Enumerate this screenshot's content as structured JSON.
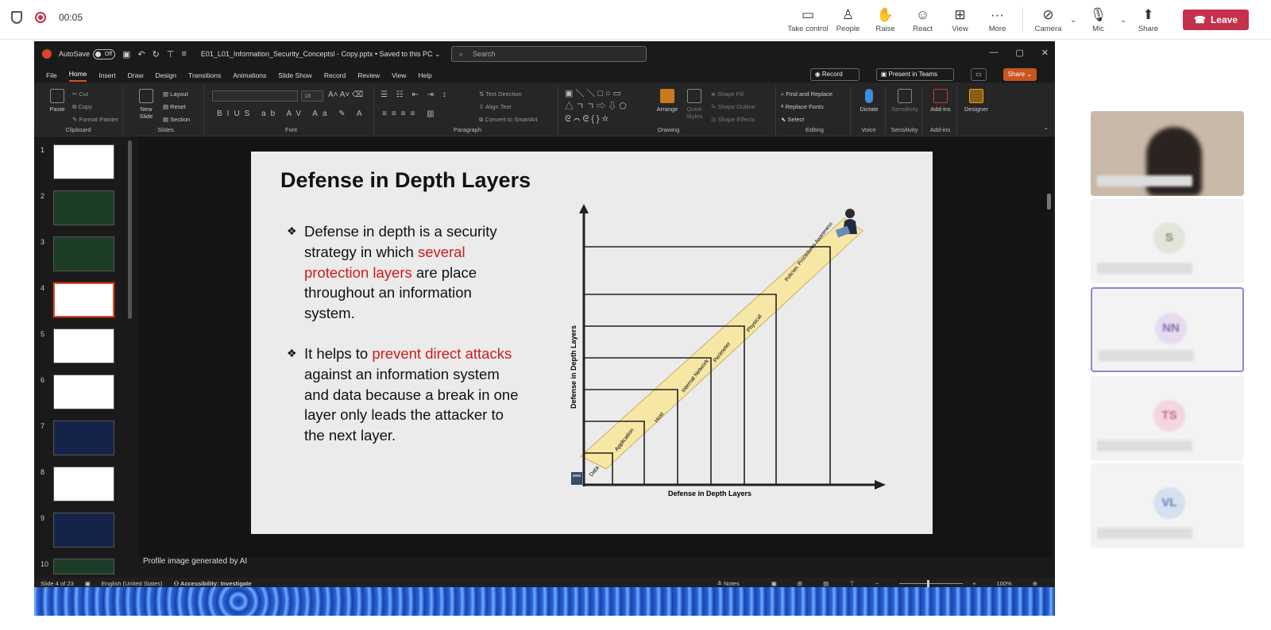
{
  "teams": {
    "timer": "00:05",
    "controls": [
      {
        "label": "Take control",
        "icon": "take-control-icon",
        "glyph": "▭"
      },
      {
        "label": "People",
        "icon": "people-icon",
        "glyph": "♙"
      },
      {
        "label": "Raise",
        "icon": "raise-hand-icon",
        "glyph": "✋"
      },
      {
        "label": "React",
        "icon": "react-icon",
        "glyph": "☺"
      },
      {
        "label": "View",
        "icon": "view-icon",
        "glyph": "⊞"
      },
      {
        "label": "More",
        "icon": "more-icon",
        "glyph": "···"
      }
    ],
    "camera_label": "Camera",
    "mic_label": "Mic",
    "share_label": "Share",
    "leave_label": "Leave"
  },
  "ppt": {
    "autosave_label": "AutoSave",
    "autosave_state": "Off",
    "filename": "E01_L01_Information_Security_Conceptsl - Copy.pptx • Saved to this PC ⌄",
    "search_placeholder": "Search",
    "menus": [
      "File",
      "Home",
      "Insert",
      "Draw",
      "Design",
      "Transitions",
      "Animations",
      "Slide Show",
      "Record",
      "Review",
      "View",
      "Help"
    ],
    "record_label": "Record",
    "present_label": "Present in Teams",
    "share_label": "Share ⌄",
    "ribbon": {
      "paste": "Paste",
      "cut": "Cut",
      "copy": "Copy",
      "format_painter": "Format Painter",
      "clipboard": "Clipboard",
      "new_slide": "New Slide",
      "layout": "Layout",
      "reset": "Reset",
      "section": "Section",
      "slides": "Slides",
      "font_size": "18",
      "font": "Font",
      "paragraph": "Paragraph",
      "text_direction": "Text Direction",
      "align_text": "Align Text",
      "convert_smartart": "Convert to SmartArt",
      "arrange": "Arrange",
      "quick_styles": "Quick Styles",
      "shape_fill": "Shape Fill",
      "shape_outline": "Shape Outline",
      "shape_effects": "Shape Effects",
      "drawing": "Drawing",
      "find_replace": "Find and Replace",
      "replace_fonts": "Replace Fonts",
      "select": "Select",
      "editing": "Editing",
      "dictate": "Dictate",
      "voice": "Voice",
      "sensitivity": "Sensitivity",
      "sensitivity_grp": "Sensitivity",
      "addins": "Add-ins",
      "addins_grp": "Add-ins",
      "designer": "Designer"
    },
    "slide_numbers": [
      "1",
      "2",
      "3",
      "4",
      "5",
      "6",
      "7",
      "8",
      "9",
      "10"
    ],
    "slide": {
      "title": "Defense in Depth Layers",
      "b1_a": "Defense in depth is a security strategy in which ",
      "b1_red": "several protection layers",
      "b1_b": " are place throughout an information system.",
      "b2_a": "It helps to ",
      "b2_red": "prevent direct attacks",
      "b2_b": " against an information system and data because a break in one layer only leads the attacker to the next layer.",
      "y_axis": "Defense in Depth Layers",
      "x_axis": "Defense in Depth Layers",
      "layers": [
        "Data",
        "Application",
        "Host",
        "Internal Network",
        "Perimeter",
        "Physical",
        "Policies, Procedures Awareness"
      ]
    },
    "notes_text": "Profile image generated by AI",
    "status": {
      "slide_of": "Slide 4 of 23",
      "language": "English (United States)",
      "accessibility": "Accessibility: Investigate",
      "notes": "Notes",
      "zoom": "100%"
    }
  },
  "participants": [
    {
      "initials": "",
      "kind": "video"
    },
    {
      "initials": "S",
      "bg": "#e2e6da",
      "fg": "#7a8a6a"
    },
    {
      "initials": "NN",
      "bg": "#e6dcef",
      "fg": "#8b6aa8",
      "highlight": true
    },
    {
      "initials": "TS",
      "bg": "#f3d6de",
      "fg": "#c06a85"
    },
    {
      "initials": "VL",
      "bg": "#d6e1f0",
      "fg": "#5e7fb0"
    }
  ]
}
